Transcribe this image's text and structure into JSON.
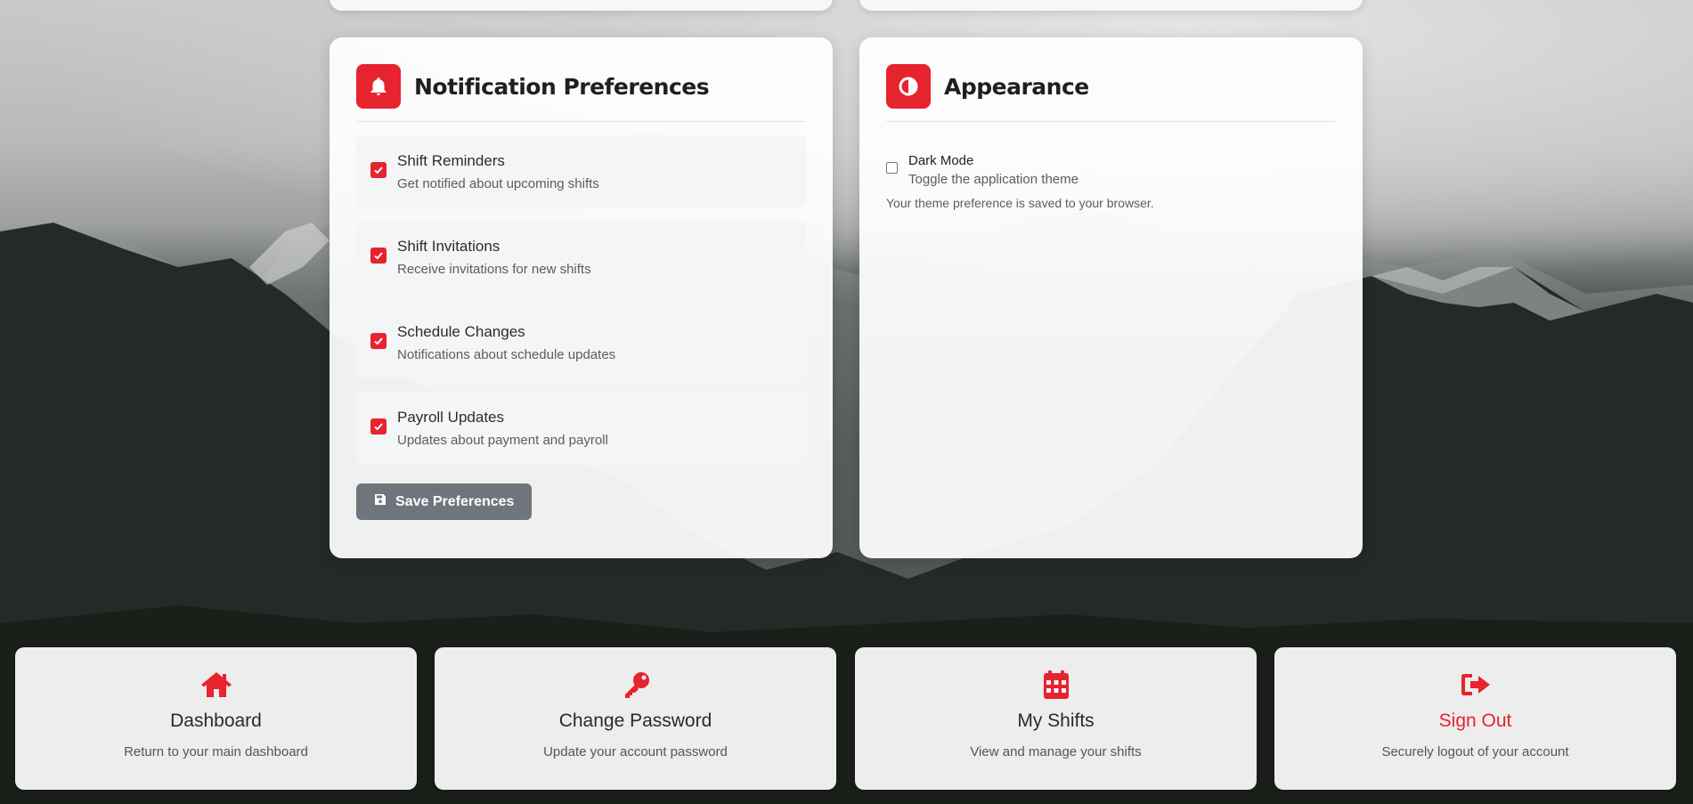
{
  "theme": {
    "accent": "#e7232d",
    "button_gray": "#6e757c"
  },
  "notifications": {
    "title": "Notification Preferences",
    "icon": "bell-icon",
    "items": [
      {
        "title": "Shift Reminders",
        "description": "Get notified about upcoming shifts",
        "checked": true
      },
      {
        "title": "Shift Invitations",
        "description": "Receive invitations for new shifts",
        "checked": true
      },
      {
        "title": "Schedule Changes",
        "description": "Notifications about schedule updates",
        "checked": true
      },
      {
        "title": "Payroll Updates",
        "description": "Updates about payment and payroll",
        "checked": true
      }
    ],
    "save_label": "Save Preferences"
  },
  "appearance": {
    "title": "Appearance",
    "icon": "contrast-icon",
    "dark_mode": {
      "label": "Dark Mode",
      "description": "Toggle the application theme",
      "checked": false
    },
    "note": "Your theme preference is saved to your browser."
  },
  "nav_cards": [
    {
      "icon": "home-icon",
      "title": "Dashboard",
      "description": "Return to your main dashboard"
    },
    {
      "icon": "key-icon",
      "title": "Change Password",
      "description": "Update your account password"
    },
    {
      "icon": "calendar-icon",
      "title": "My Shifts",
      "description": "View and manage your shifts"
    },
    {
      "icon": "sign-out-icon",
      "title": "Sign Out",
      "description": "Securely logout of your account"
    }
  ]
}
